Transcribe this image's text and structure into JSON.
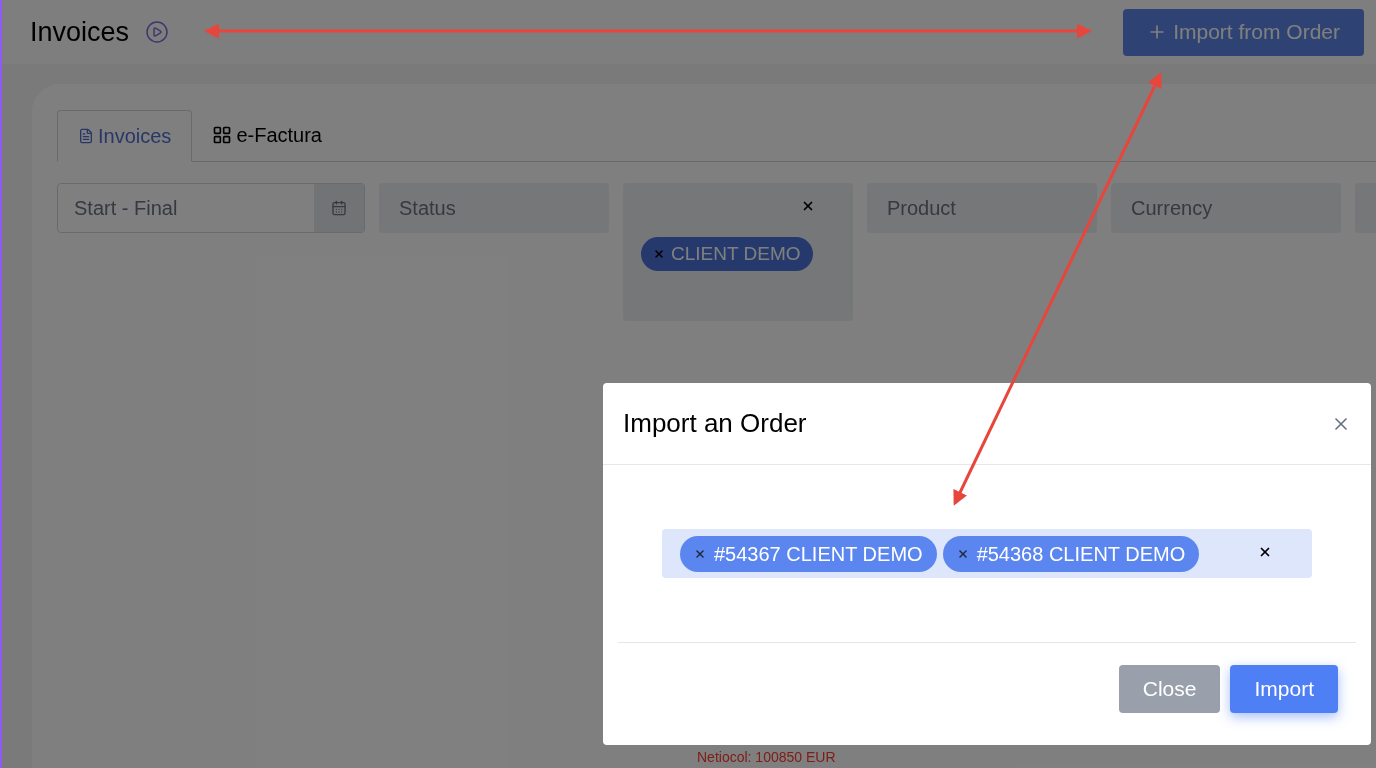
{
  "page": {
    "title": "Invoices",
    "import_button": "Import from Order"
  },
  "tabs": [
    {
      "label": "Invoices",
      "selected": true,
      "kind": "document"
    },
    {
      "label": "e-Factura",
      "selected": false,
      "kind": "apps"
    }
  ],
  "filters": [
    {
      "kind": "date",
      "placeholder": "Start - Final"
    },
    {
      "kind": "select",
      "placeholder": "Status"
    },
    {
      "kind": "tags",
      "tags": [
        "CLIENT DEMO"
      ]
    },
    {
      "kind": "select",
      "placeholder": "Product"
    },
    {
      "kind": "select",
      "placeholder": "Currency"
    }
  ],
  "row_note": "Netiocol: 100850 EUR",
  "modal": {
    "title": "Import an Order",
    "tags": [
      "#54367 CLIENT DEMO",
      "#54368 CLIENT DEMO"
    ],
    "buttons": [
      {
        "label": "Close",
        "kind": "secondary"
      },
      {
        "label": "Import",
        "kind": "primary"
      }
    ]
  }
}
